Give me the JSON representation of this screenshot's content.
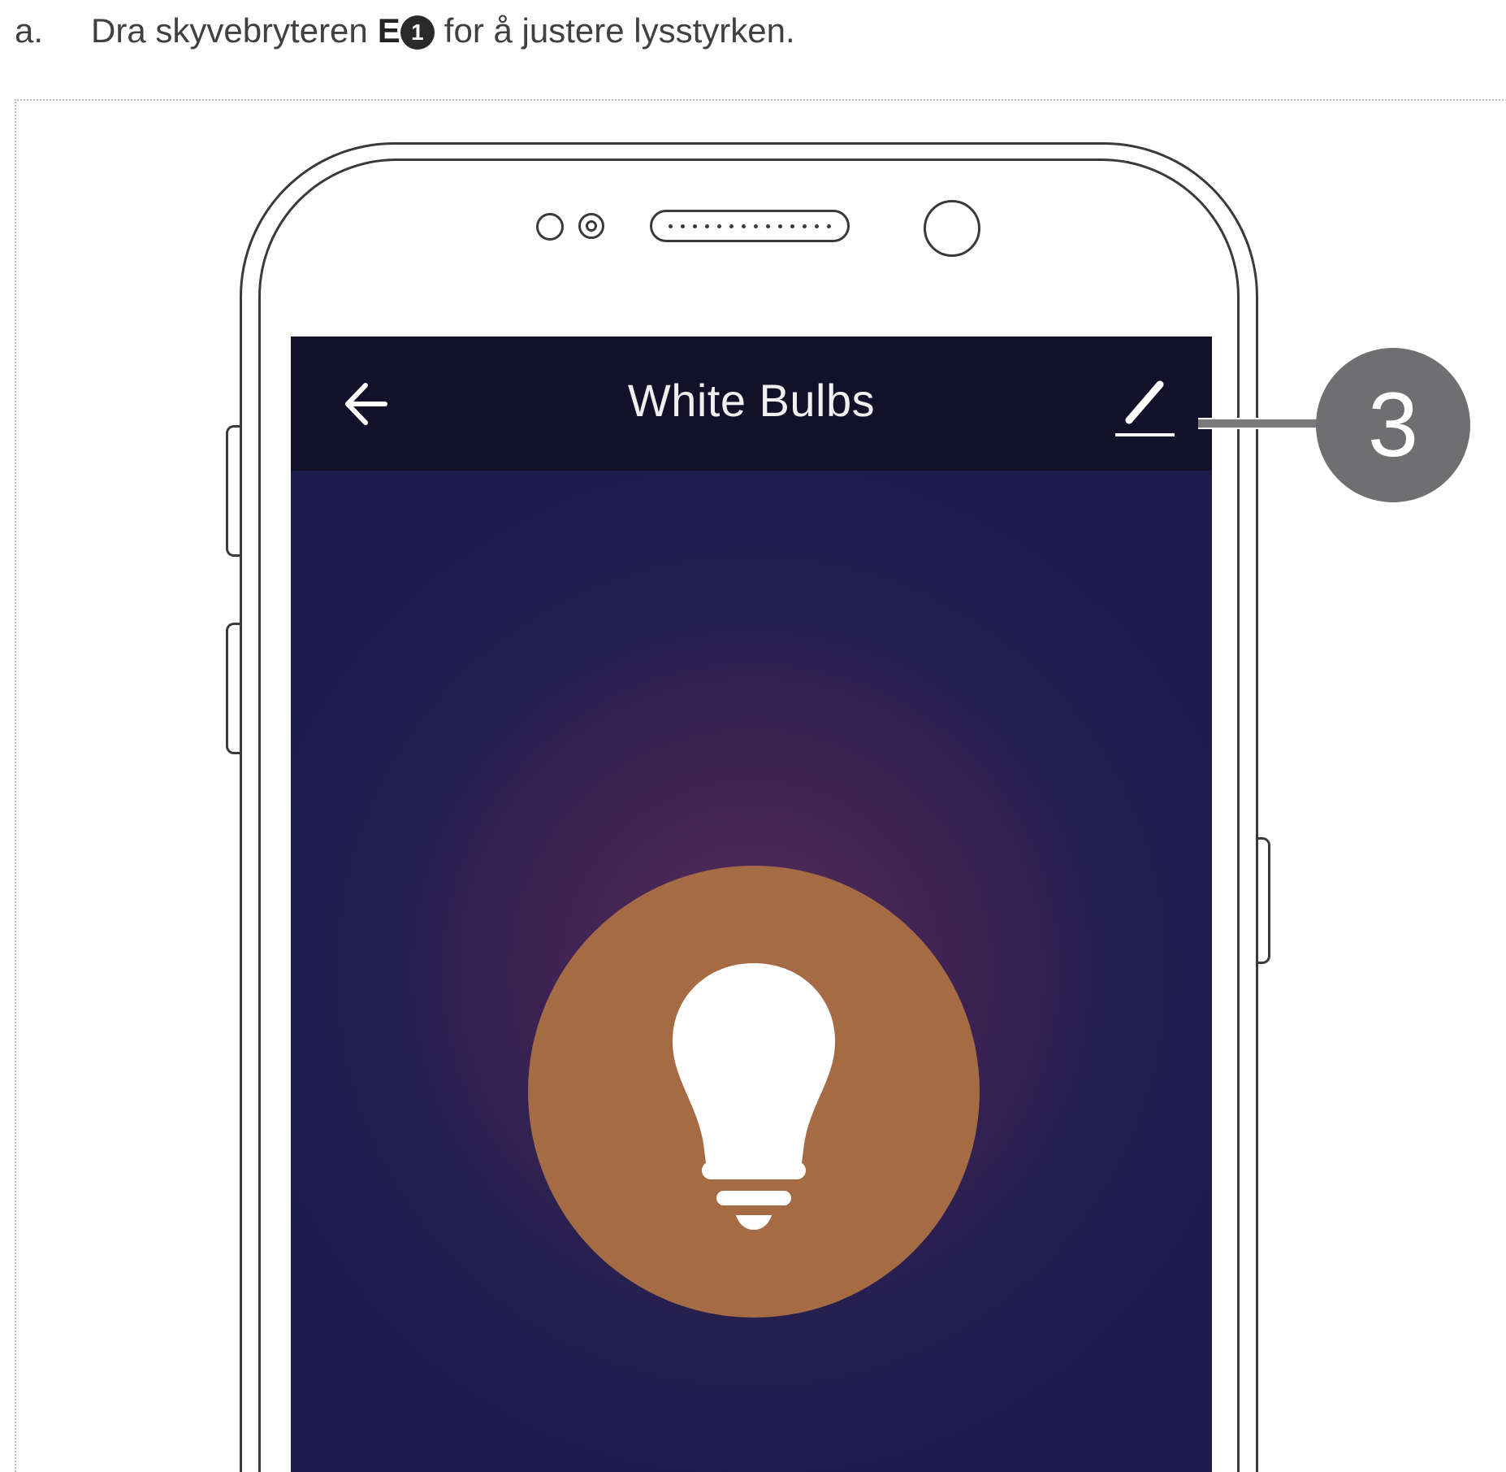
{
  "instruction": {
    "step_letter": "a.",
    "text_before": "Dra skyvebryteren",
    "control_code": "E",
    "control_number": "1",
    "text_after": "for å justere lysstyrken."
  },
  "app": {
    "title": "White Bulbs",
    "back_icon": "arrow-left-icon",
    "edit_icon": "pencil-edit-icon",
    "bulb_icon": "light-bulb-icon"
  },
  "callout": {
    "number": "3"
  },
  "colors": {
    "appbar": "#121129",
    "screen": "#1c1c4e",
    "bulb_button": "#a56b45",
    "callout": "#6f6f72"
  }
}
